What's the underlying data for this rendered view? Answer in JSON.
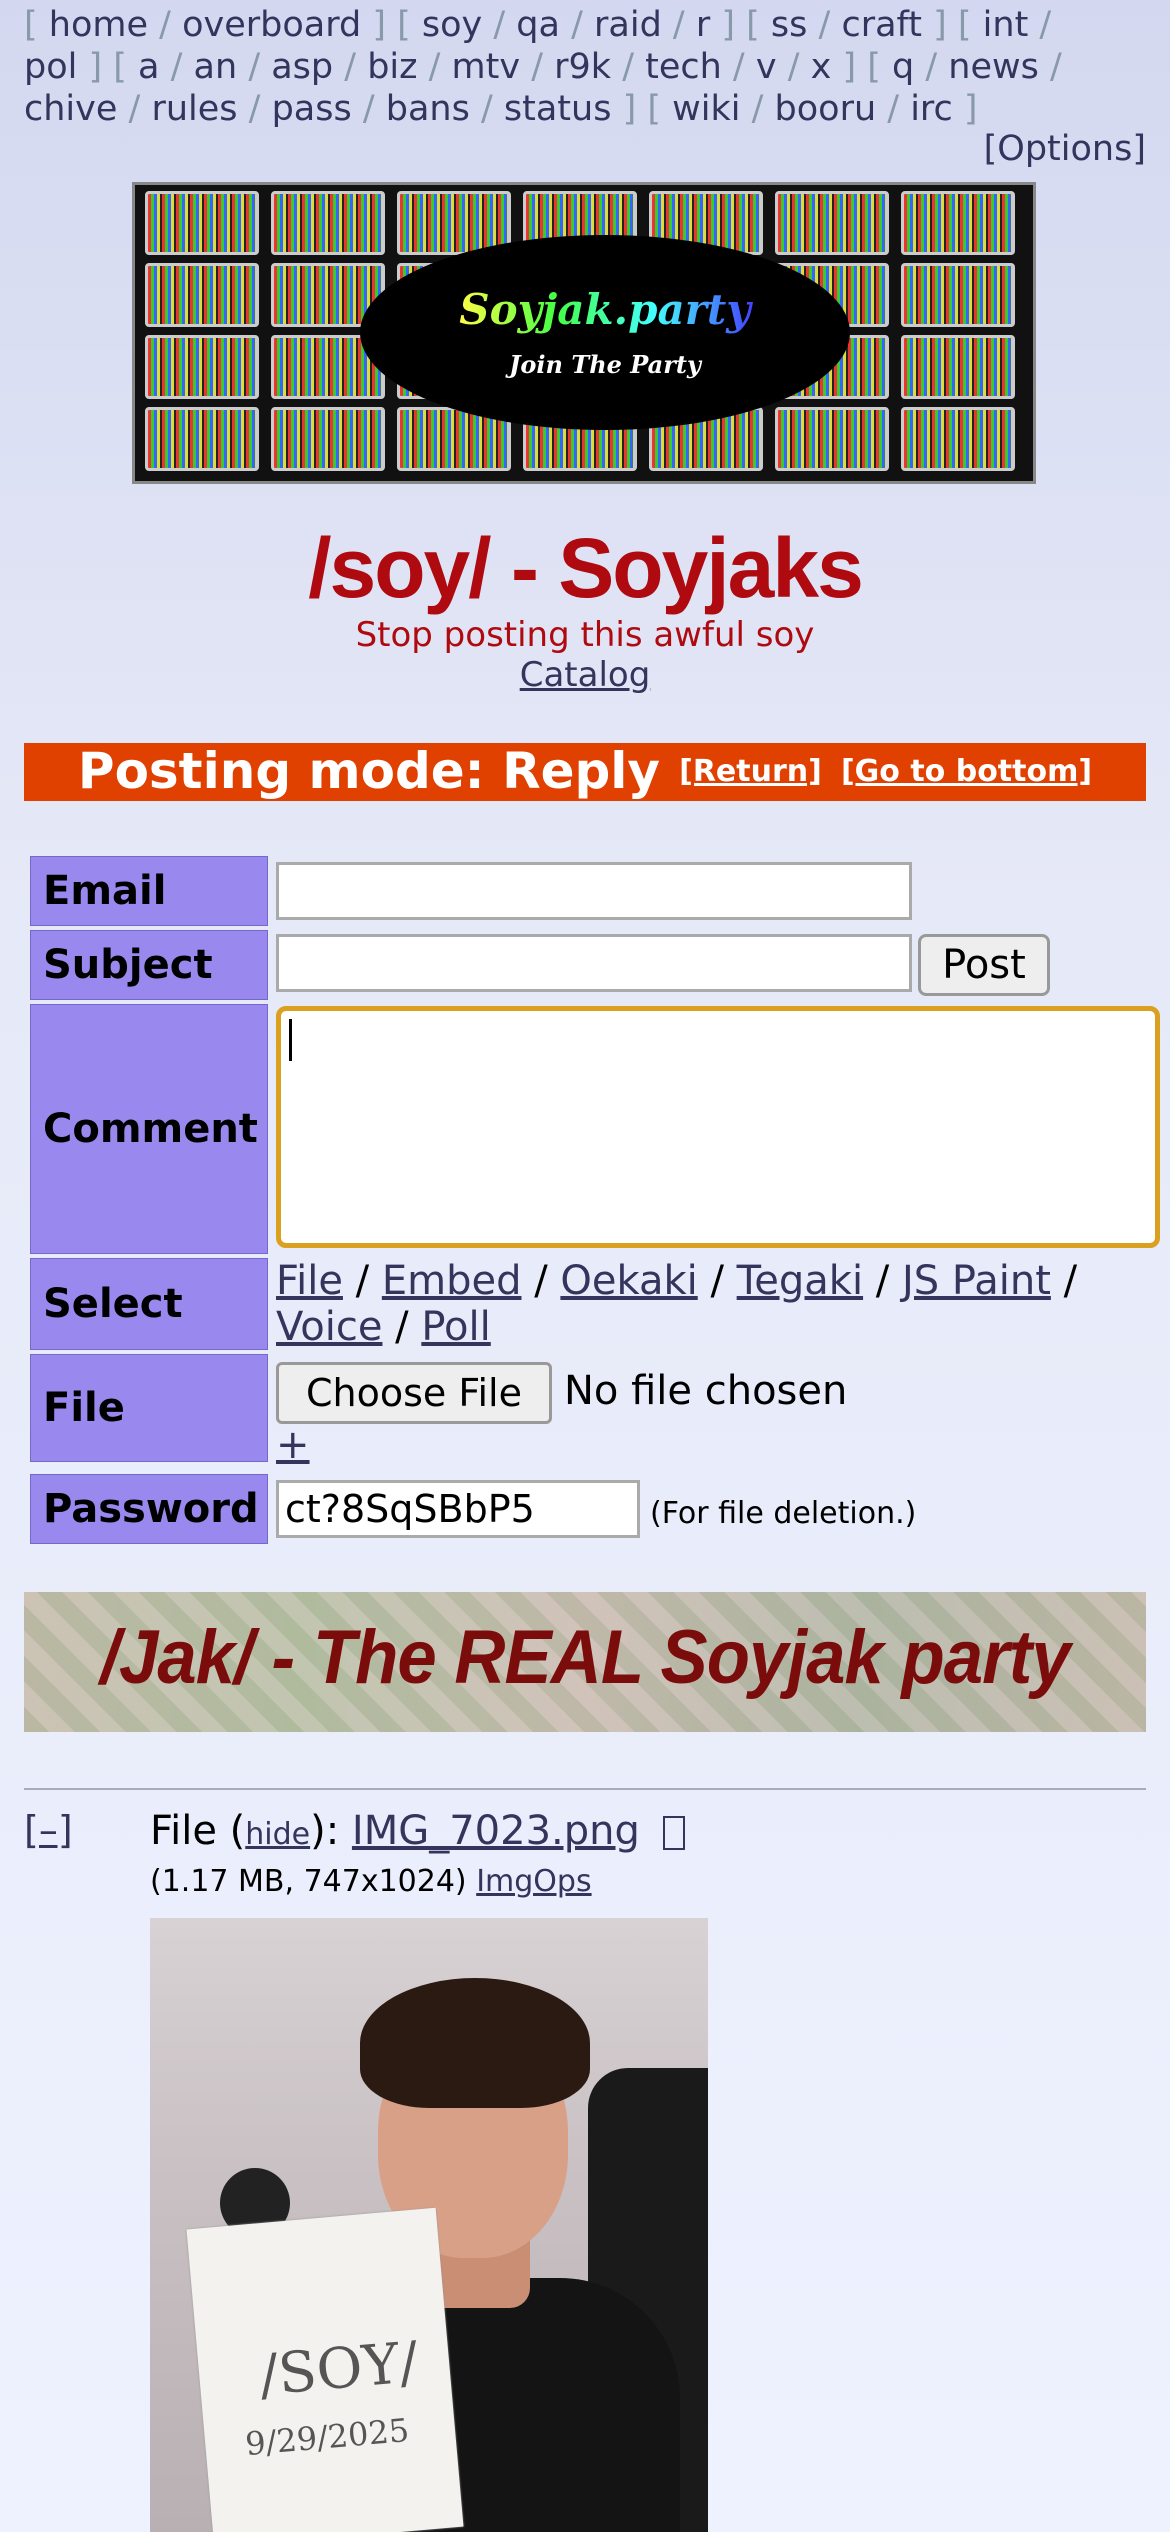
{
  "nav": {
    "groups": [
      [
        "home",
        "overboard"
      ],
      [
        "soy",
        "qa",
        "raid",
        "r"
      ],
      [
        "ss",
        "craft"
      ],
      [
        "int",
        "pol"
      ],
      [
        "a",
        "an",
        "asp",
        "biz",
        "mtv",
        "r9k",
        "tech",
        "v",
        "x"
      ],
      [
        "q",
        "news",
        "chive",
        "rules",
        "pass",
        "bans",
        "status"
      ],
      [
        "wiki",
        "booru",
        "irc"
      ]
    ],
    "options_label": "[Options]"
  },
  "banner": {
    "title": "Soyjak.party",
    "subtitle": "Join The Party"
  },
  "board": {
    "title": "/soy/ - Soyjaks",
    "subtitle": "Stop posting this awful soy",
    "catalog_label": "Catalog"
  },
  "mode_bar": {
    "text": "Posting mode: Reply",
    "return_label": "[Return]",
    "bottom_label": "[Go to bottom]"
  },
  "form": {
    "email_label": "Email",
    "subject_label": "Subject",
    "comment_label": "Comment",
    "select_label": "Select",
    "file_label": "File",
    "password_label": "Password",
    "email_value": "",
    "subject_value": "",
    "post_button": "Post",
    "select_options": [
      "File",
      "Embed",
      "Oekaki",
      "Tegaki",
      "JS Paint",
      "Voice",
      "Poll"
    ],
    "choose_file_button": "Choose File",
    "no_file_text": "No file chosen",
    "add_file": "+",
    "password_value": "ct?8SqSBbP5",
    "password_note": "(For file deletion.)"
  },
  "ad_banner": {
    "text": "/Jak/ - The REAL Soyjak party"
  },
  "thread": {
    "toggle": "[–]",
    "file_prefix": "File (",
    "hide_label": "hide",
    "file_mid": "): ",
    "filename": "IMG_7023.png",
    "file_meta_pre": "(1.17 MB, 747x1024) ",
    "imgops_label": "ImgOps",
    "image_text_line1": "/SOY/",
    "image_text_line2": "9/29/2025"
  },
  "colors": {
    "board_title": "#af0a0f",
    "mode_bar_bg": "#e04000",
    "label_bg": "#9988ee",
    "link": "#34345c"
  }
}
